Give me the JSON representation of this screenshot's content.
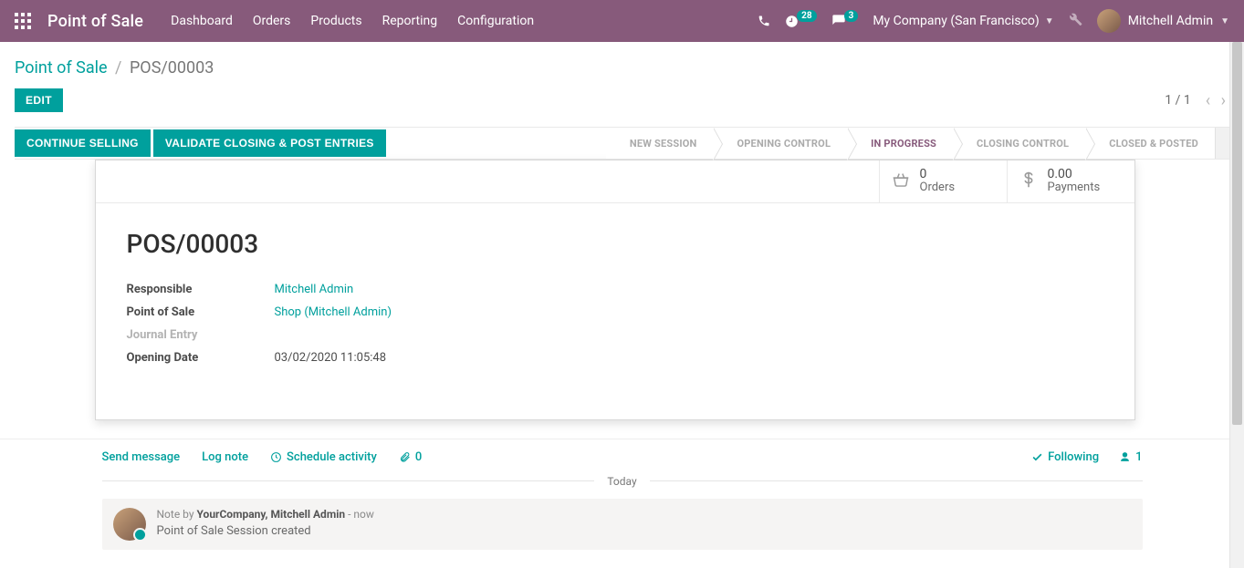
{
  "navbar": {
    "brand": "Point of Sale",
    "menu": [
      "Dashboard",
      "Orders",
      "Products",
      "Reporting",
      "Configuration"
    ],
    "activities_badge": "28",
    "discuss_badge": "3",
    "company": "My Company (San Francisco)",
    "user": "Mitchell Admin"
  },
  "breadcrumb": {
    "root": "Point of Sale",
    "current": "POS/00003"
  },
  "buttons": {
    "edit": "EDIT",
    "continue_selling": "CONTINUE SELLING",
    "validate_close": "VALIDATE CLOSING & POST ENTRIES"
  },
  "pager": {
    "text": "1 / 1"
  },
  "status_steps": [
    "NEW SESSION",
    "OPENING CONTROL",
    "IN PROGRESS",
    "CLOSING CONTROL",
    "CLOSED & POSTED"
  ],
  "stats": {
    "orders_value": "0",
    "orders_label": "Orders",
    "payments_value": "0.00",
    "payments_label": "Payments"
  },
  "record": {
    "title": "POS/00003",
    "labels": {
      "responsible": "Responsible",
      "point_of_sale": "Point of Sale",
      "journal_entry": "Journal Entry",
      "opening_date": "Opening Date"
    },
    "values": {
      "responsible": "Mitchell Admin",
      "point_of_sale": "Shop (Mitchell Admin)",
      "opening_date": "03/02/2020 11:05:48"
    }
  },
  "chatter": {
    "send_message": "Send message",
    "log_note": "Log note",
    "schedule_activity": "Schedule activity",
    "attachments_count": "0",
    "following": "Following",
    "followers_count": "1",
    "separator": "Today",
    "note": {
      "prefix": "Note by ",
      "author": "YourCompany, Mitchell Admin",
      "time": "now",
      "body": "Point of Sale Session created"
    }
  }
}
